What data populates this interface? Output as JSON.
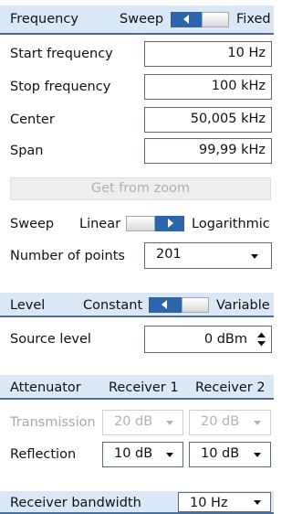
{
  "frequency": {
    "header": "Frequency",
    "mode_left": "Sweep",
    "mode_right": "Fixed",
    "start_label": "Start frequency",
    "start_value": "10 Hz",
    "stop_label": "Stop frequency",
    "stop_value": "100 kHz",
    "center_label": "Center",
    "center_value": "50,005 kHz",
    "span_label": "Span",
    "span_value": "99,99 kHz",
    "zoom_button": "Get from zoom",
    "sweep_label": "Sweep",
    "sweep_left": "Linear",
    "sweep_right": "Logarithmic",
    "points_label": "Number of points",
    "points_value": "201"
  },
  "level": {
    "header": "Level",
    "mode_left": "Constant",
    "mode_right": "Variable",
    "source_label": "Source level",
    "source_value": "0 dBm"
  },
  "attenuator": {
    "header": "Attenuator",
    "receiver1": "Receiver 1",
    "receiver2": "Receiver 2",
    "transmission_label": "Transmission",
    "transmission_r1": "20 dB",
    "transmission_r2": "20 dB",
    "reflection_label": "Reflection",
    "reflection_r1": "10 dB",
    "reflection_r2": "10 dB"
  },
  "bandwidth": {
    "label": "Receiver bandwidth",
    "value": "10 Hz"
  },
  "colors": {
    "header_bg": "#d9e7f7",
    "header_line": "#4a6e98",
    "toggle_blue": "#2b66ad"
  }
}
